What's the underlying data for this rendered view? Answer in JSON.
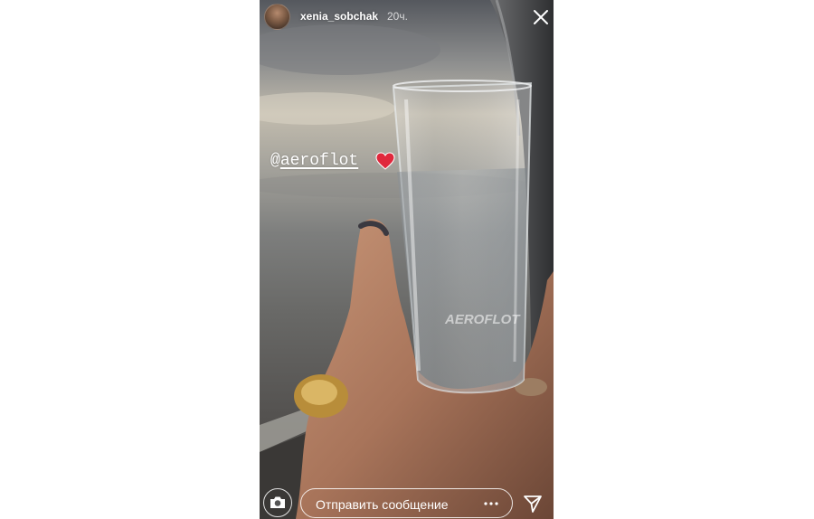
{
  "story": {
    "username": "xenia_sobchak",
    "timestamp": "20ч.",
    "mention_prefix": "@",
    "mention_handle": "aeroflot",
    "heart_color": "#e0283c",
    "glass_print": "AEROFLOT"
  },
  "footer": {
    "message_placeholder": "Отправить сообщение"
  },
  "icons": {
    "close": "close-icon",
    "camera": "camera-icon",
    "more": "more-dots-icon",
    "send": "send-icon",
    "heart": "heart-icon"
  }
}
